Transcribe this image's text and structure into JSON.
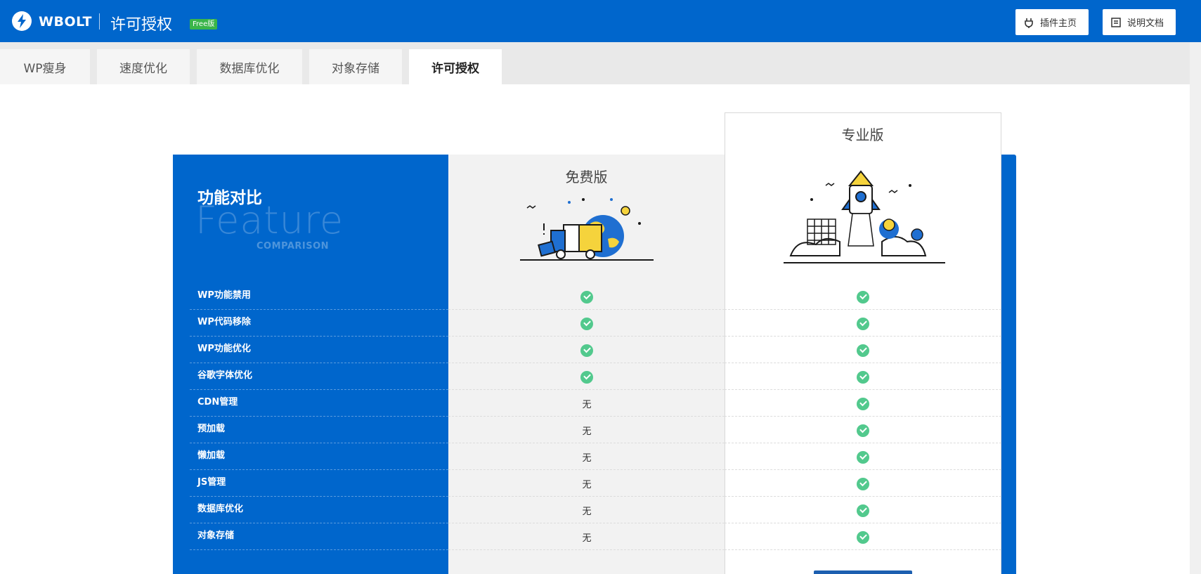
{
  "header": {
    "brand": "WBOLT",
    "page_title": "许可授权",
    "badge": "Free版",
    "buttons": [
      {
        "label": "插件主页",
        "icon": "plug-icon"
      },
      {
        "label": "说明文档",
        "icon": "document-icon"
      }
    ],
    "accent_color": "#0066cc"
  },
  "tabs": [
    {
      "label": "WP瘦身",
      "active": false
    },
    {
      "label": "速度优化",
      "active": false
    },
    {
      "label": "数据库优化",
      "active": false
    },
    {
      "label": "对象存储",
      "active": false
    },
    {
      "label": "许可授权",
      "active": true
    }
  ],
  "comparison": {
    "title": "功能对比",
    "watermark": "Feature",
    "watermark_sub": "COMPARISON",
    "free_title": "免费版",
    "pro_title": "专业版",
    "none_text": "无",
    "check_color": "#52c98d",
    "rows": [
      {
        "feature": "WP功能禁用",
        "free": true,
        "pro": true
      },
      {
        "feature": "WP代码移除",
        "free": true,
        "pro": true
      },
      {
        "feature": "WP功能优化",
        "free": true,
        "pro": true
      },
      {
        "feature": "谷歌字体优化",
        "free": true,
        "pro": true
      },
      {
        "feature": "CDN管理",
        "free": false,
        "pro": true
      },
      {
        "feature": "预加载",
        "free": false,
        "pro": true
      },
      {
        "feature": "懒加载",
        "free": false,
        "pro": true
      },
      {
        "feature": "JS管理",
        "free": false,
        "pro": true
      },
      {
        "feature": "数据库优化",
        "free": false,
        "pro": true
      },
      {
        "feature": "对象存储",
        "free": false,
        "pro": true
      }
    ]
  }
}
